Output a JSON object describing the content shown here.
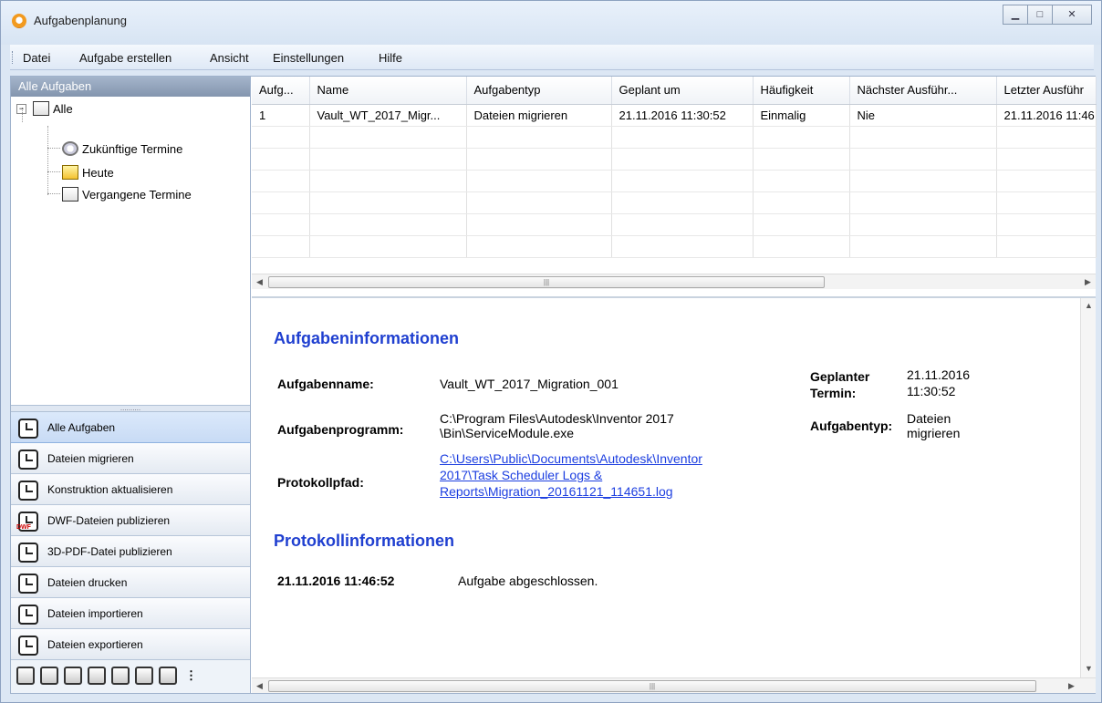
{
  "window": {
    "title": "Aufgabenplanung"
  },
  "menu": [
    "Datei",
    "Aufgabe erstellen",
    "Ansicht",
    "Einstellungen",
    "Hilfe"
  ],
  "left_panel": {
    "header": "Alle Aufgaben",
    "tree": {
      "root": "Alle",
      "children": [
        "Zukünftige Termine",
        "Heute",
        "Vergangene Termine"
      ]
    },
    "nav_buttons": [
      "Alle Aufgaben",
      "Dateien migrieren",
      "Konstruktion aktualisieren",
      "DWF-Dateien publizieren",
      "3D-PDF-Datei publizieren",
      "Dateien drucken",
      "Dateien importieren",
      "Dateien exportieren"
    ],
    "dwf_badge": "DWF"
  },
  "grid": {
    "columns": [
      "Aufg...",
      "Name",
      "Aufgabentyp",
      "Geplant um",
      "Häufigkeit",
      "Nächster Ausführ...",
      "Letzter Ausführ"
    ],
    "rows": [
      [
        "1",
        "Vault_WT_2017_Migr...",
        "Dateien migrieren",
        "21.11.2016 11:30:52",
        "Einmalig",
        "Nie",
        "21.11.2016 11:46"
      ]
    ]
  },
  "info": {
    "title": "Aufgabeninformationen",
    "task_name_label": "Aufgabenname:",
    "task_name_value": "Vault_WT_2017_Migration_001",
    "program_label": "Aufgabenprogramm:",
    "program_value_1": "C:\\Program Files\\Autodesk\\Inventor 2017",
    "program_value_2": "\\Bin\\ServiceModule.exe",
    "log_label": "Protokollpfad:",
    "log_value_1": "C:\\Users\\Public\\Documents\\Autodesk\\Inventor",
    "log_value_2": "2017\\Task Scheduler Logs &",
    "log_value_3": "Reports\\Migration_20161121_114651.log",
    "scheduled_label_1": "Geplanter",
    "scheduled_label_2": "Termin:",
    "scheduled_value_1": "21.11.2016",
    "scheduled_value_2": "11:30:52",
    "type_label": "Aufgabentyp:",
    "type_value_1": "Dateien",
    "type_value_2": "migrieren",
    "log_section_title": "Protokollinformationen",
    "log_entry_time": "21.11.2016 11:46:52",
    "log_entry_text": "Aufgabe abgeschlossen."
  },
  "colors": {
    "link": "#1c3ee0",
    "section_title": "#1f3fd0"
  },
  "icons": {
    "minimize": "minimize-icon",
    "maximize": "maximize-icon",
    "close": "close-icon"
  }
}
